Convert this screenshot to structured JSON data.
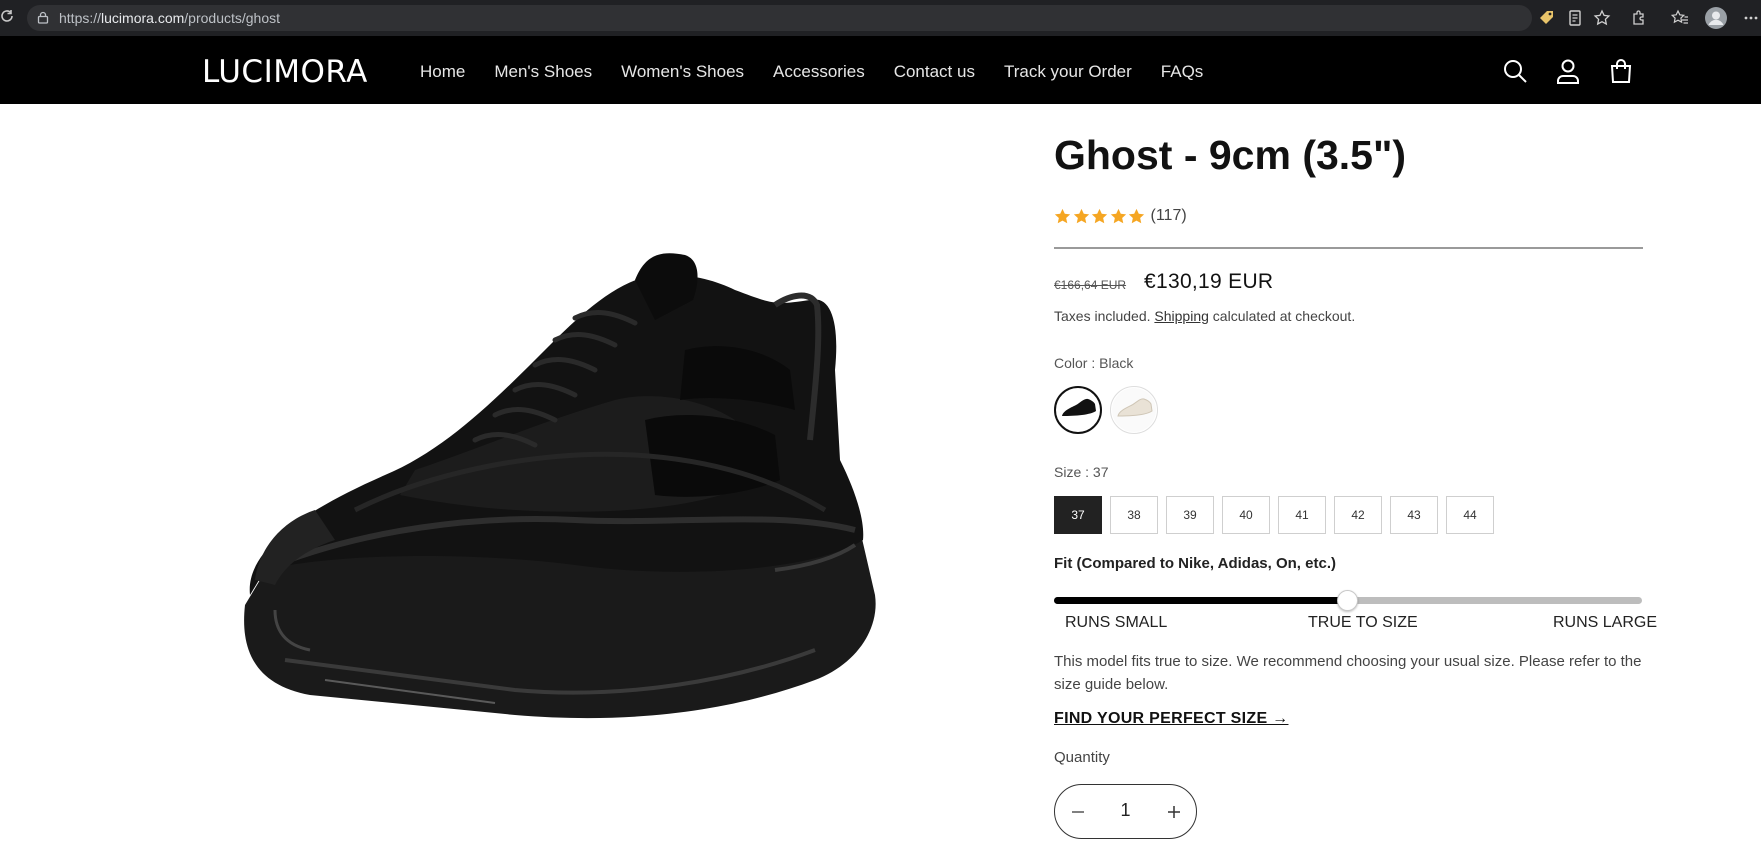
{
  "browser": {
    "url_prefix": "https://",
    "url_host": "lucimora.com",
    "url_path": "/products/ghost"
  },
  "header": {
    "logo": "LUCIMORA",
    "nav": [
      {
        "label": "Home"
      },
      {
        "label": "Men's Shoes"
      },
      {
        "label": "Women's Shoes"
      },
      {
        "label": "Accessories"
      },
      {
        "label": "Contact us"
      },
      {
        "label": "Track your Order"
      },
      {
        "label": "FAQs"
      }
    ],
    "icons": [
      "search-icon",
      "account-icon",
      "cart-icon"
    ]
  },
  "product": {
    "title": "Ghost - 9cm (3.5\")",
    "rating": {
      "stars": 5,
      "count": "(117)"
    },
    "old_price": "€166,64 EUR",
    "price": "€130,19 EUR",
    "tax_before": "Taxes included. ",
    "tax_link": "Shipping",
    "tax_after": " calculated at checkout.",
    "color_label": "Color : Black",
    "colors": [
      {
        "name": "Black",
        "selected": true,
        "hex": "#111111"
      },
      {
        "name": "Beige",
        "selected": false,
        "hex": "#e9e2d6"
      }
    ],
    "size_label": "Size : 37",
    "sizes": [
      {
        "label": "37",
        "selected": true
      },
      {
        "label": "38"
      },
      {
        "label": "39"
      },
      {
        "label": "40"
      },
      {
        "label": "41"
      },
      {
        "label": "42"
      },
      {
        "label": "43"
      },
      {
        "label": "44"
      }
    ],
    "fit": {
      "title": "Fit (Compared to Nike, Adidas, On, etc.)",
      "value": 0.5,
      "left": "RUNS SMALL",
      "middle": "TRUE TO SIZE",
      "right": "RUNS LARGE",
      "description": "This model fits true to size. We recommend choosing your usual size. Please refer to the size guide below."
    },
    "size_guide": "FIND YOUR PERFECT SIZE →",
    "quantity_label": "Quantity",
    "quantity": "1"
  },
  "colors": {
    "header_bg": "#000000",
    "star": "#f5a623",
    "accent": "#222222"
  }
}
